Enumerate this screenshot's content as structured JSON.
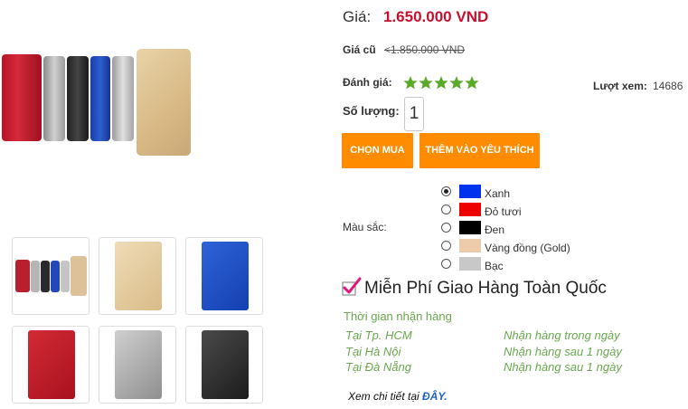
{
  "product": {
    "price_label": "Giá:",
    "price": "1.650.000 VND",
    "old_price_label": "Giá cũ",
    "old_price": "<1.850.000 VND",
    "rating_label": "Đánh giá:",
    "rating_stars": 5,
    "views_label": "Lượt xem:",
    "views": "14686",
    "quantity_label": "Số lượng:",
    "quantity": "1"
  },
  "buttons": {
    "buy": "CHỌN MUA",
    "favorite": "THÊM VÀO YÊU THÍCH"
  },
  "colors": {
    "label": "Màu sắc:",
    "selected_index": 0,
    "options": [
      {
        "name": "Xanh",
        "swatch": "#0033ee"
      },
      {
        "name": "Đỏ tươi",
        "swatch": "#ee0000"
      },
      {
        "name": "Đen",
        "swatch": "#000000"
      },
      {
        "name": "Vàng đồng (Gold)",
        "swatch": "#ecccaa"
      },
      {
        "name": "Bạc",
        "swatch": "#c8c8c8"
      }
    ]
  },
  "shipping": {
    "free_text": "Miễn Phí Giao Hàng Toàn Quốc",
    "delivery_title": "Thời gian nhận hàng",
    "rows": [
      {
        "place": "Tại Tp. HCM",
        "time": "Nhận hàng trong ngày"
      },
      {
        "place": "Tại Hà Nội",
        "time": "Nhận hàng sau 1 ngày"
      },
      {
        "place": "Tại Đà Nẵng",
        "time": "Nhận hàng sau 1 ngày"
      }
    ],
    "detail_prefix": "Xem chi tiết tại",
    "detail_link": "ĐÂY."
  },
  "thumbnails": [
    {
      "name": "all-colors"
    },
    {
      "name": "gold"
    },
    {
      "name": "blue"
    },
    {
      "name": "red"
    },
    {
      "name": "silver"
    },
    {
      "name": "black"
    }
  ],
  "theme": {
    "accent": "#ff8c00",
    "price_color": "#c8102e",
    "shipping_green": "#6aa84f",
    "link_blue": "#1a62c5",
    "star_green": "#5aaa2a"
  }
}
